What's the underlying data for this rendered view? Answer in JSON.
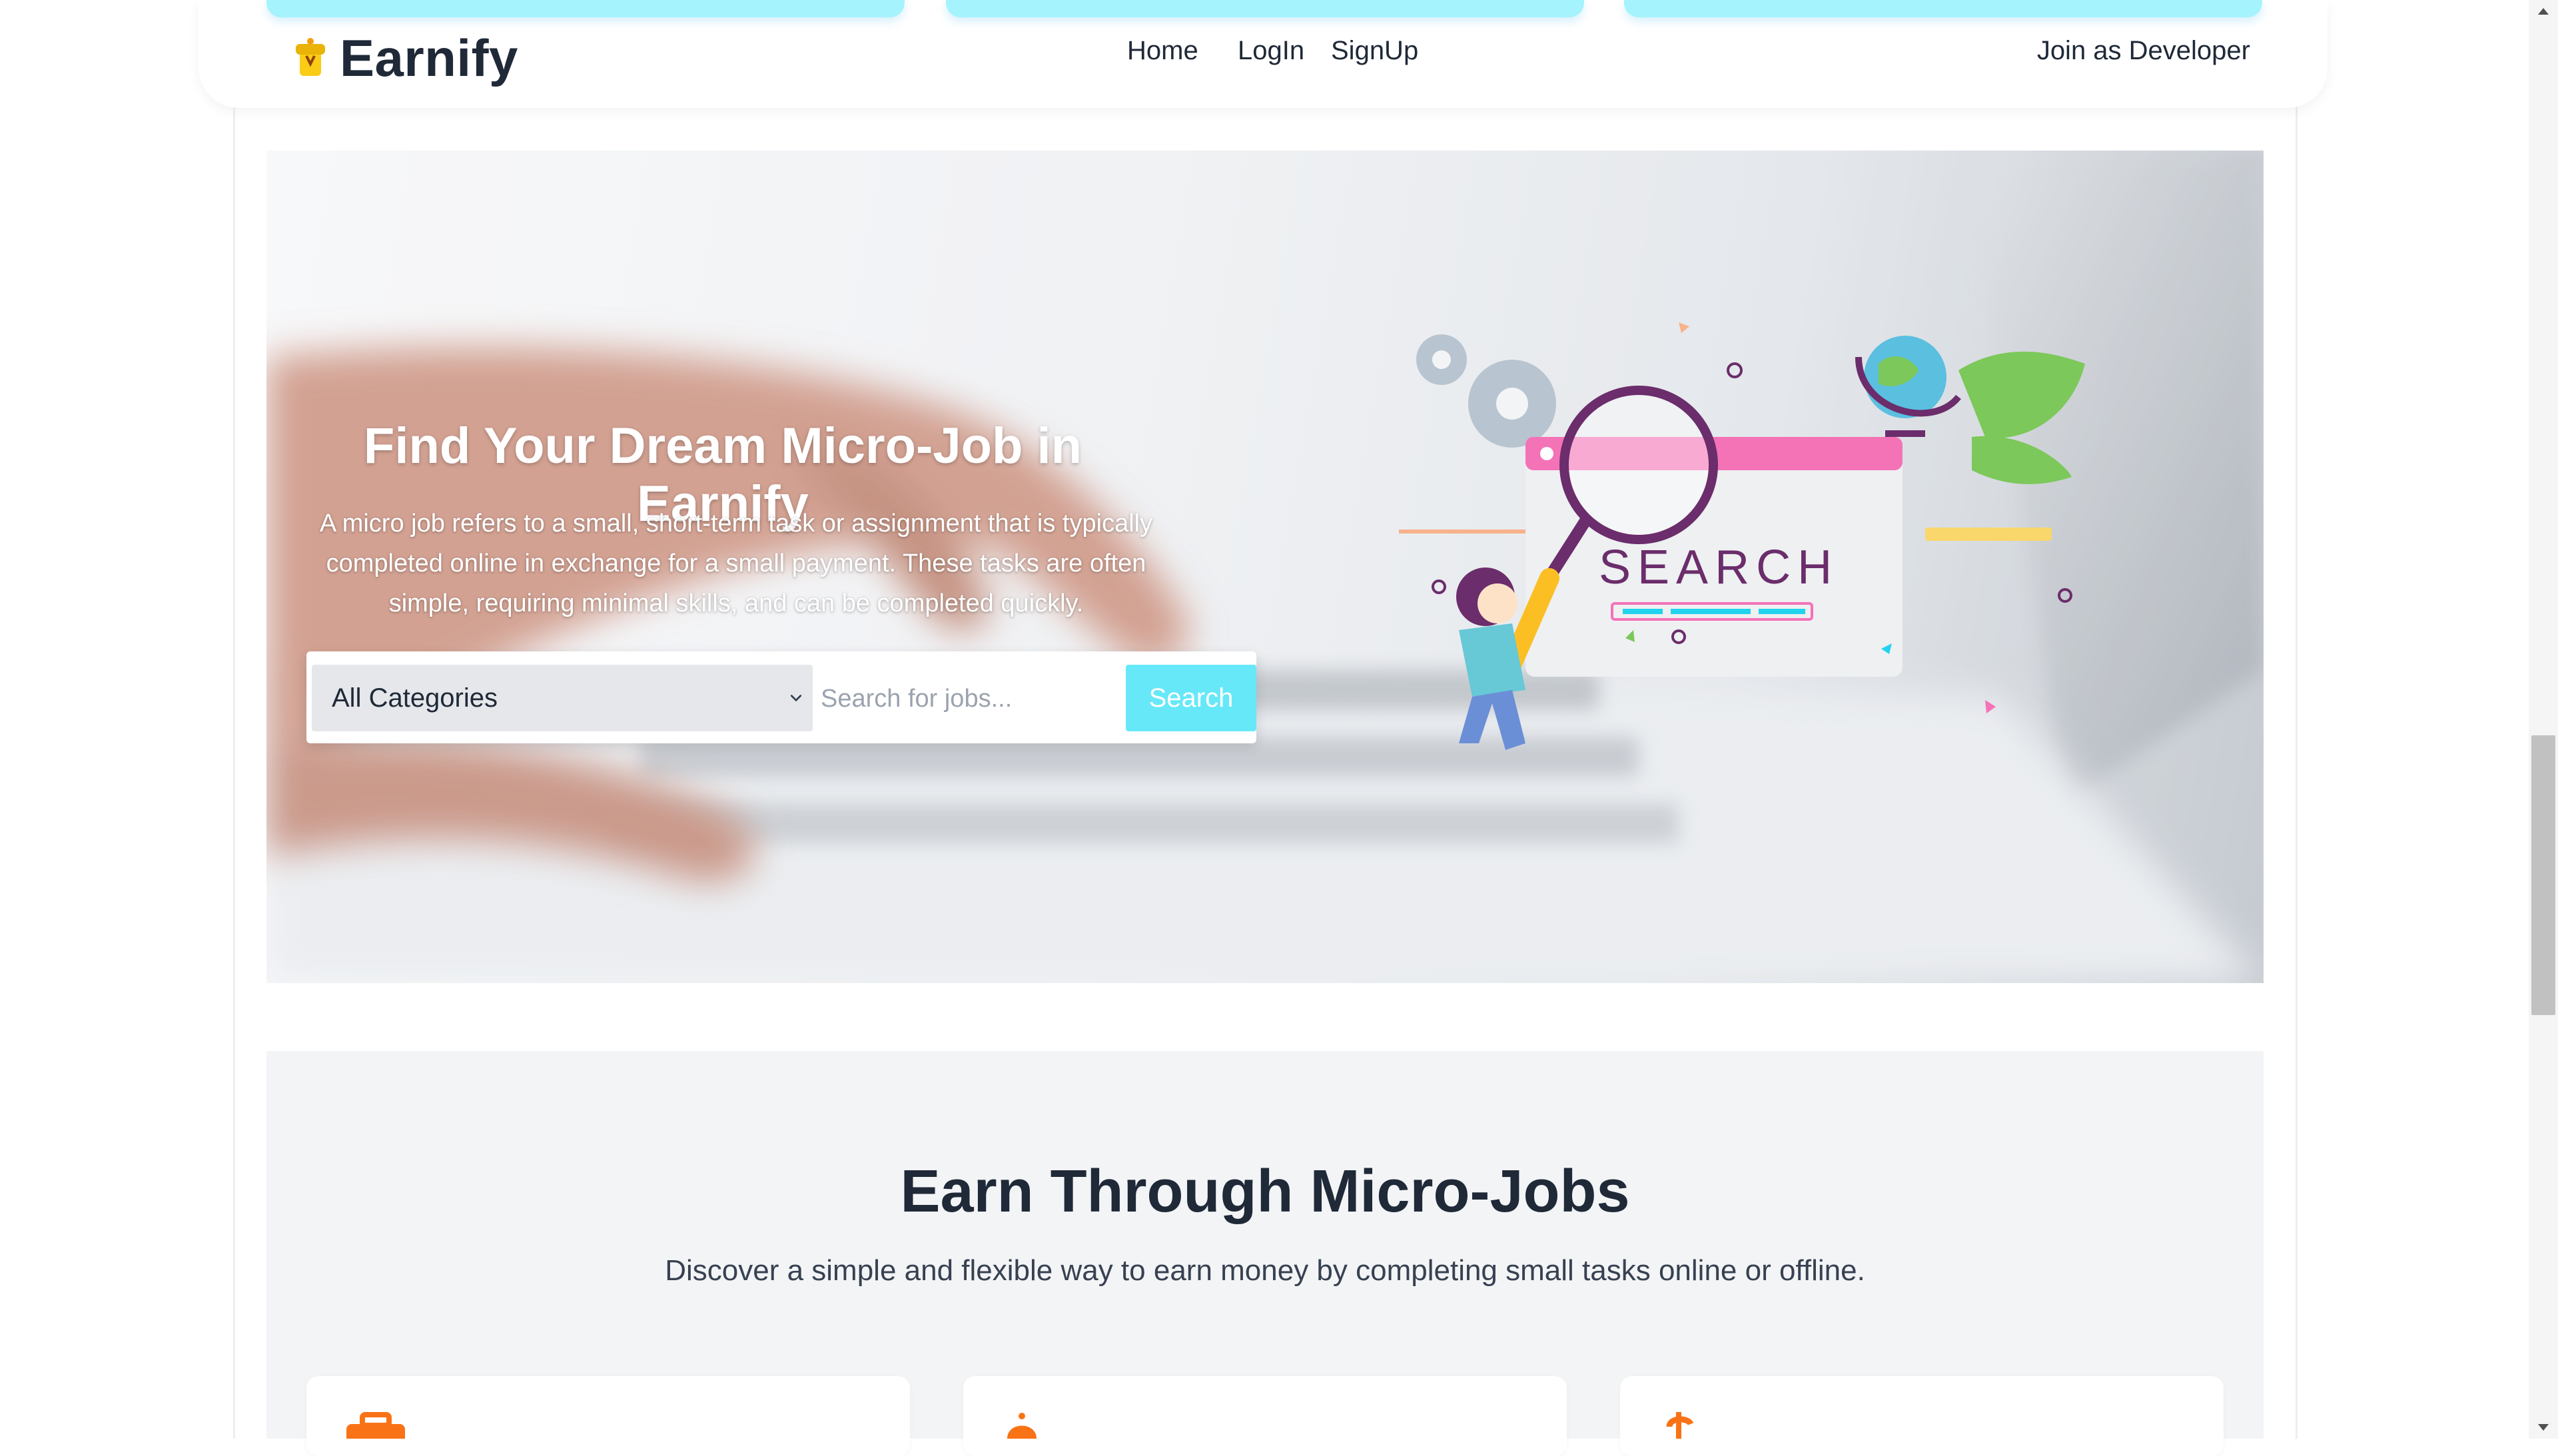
{
  "navbar": {
    "brand": "Earnify",
    "links": {
      "home": "Home",
      "login": "LogIn",
      "signup": "SignUp"
    },
    "join_developer": "Join as Developer"
  },
  "hero": {
    "title": "Find Your Dream Micro-Job in Earnify",
    "description": "A micro job refers to a small, short-term task or assignment that is typically completed online in exchange for a small payment. These tasks are often simple, requiring minimal skills, and can be completed quickly.",
    "category_select": "All Categories",
    "search_placeholder": "Search for jobs...",
    "search_button": "Search",
    "illustration_text": "SEARCH"
  },
  "section": {
    "title": "Earn Through Micro-Jobs",
    "subtitle": "Discover a simple and flexible way to earn money by completing small tasks online or offline."
  },
  "colors": {
    "accent_cyan": "#67e8f9",
    "icon_orange": "#f97316",
    "dark_text": "#1f2937"
  },
  "icons": [
    "logo-icon",
    "chevron-down-icon",
    "briefcase-icon",
    "bell-icon",
    "dollar-icon"
  ]
}
